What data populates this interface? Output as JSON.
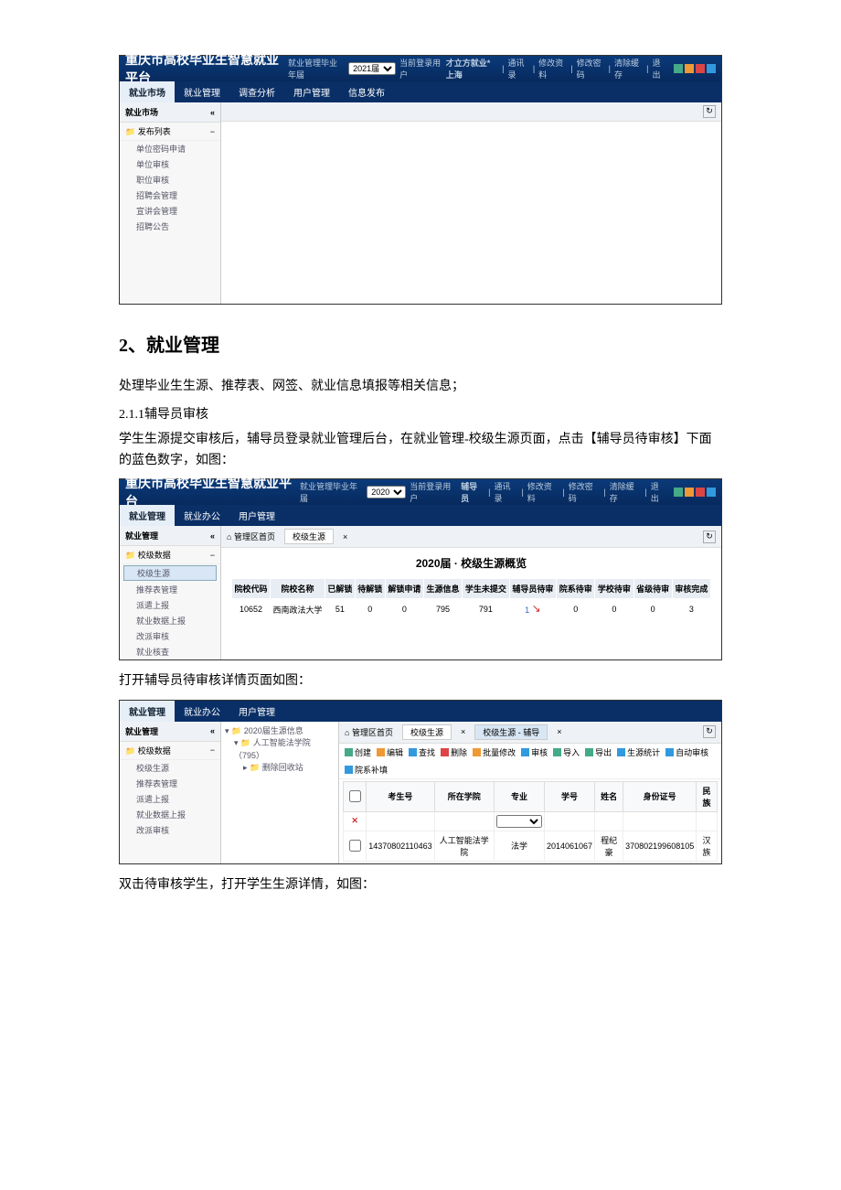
{
  "doc": {
    "section_heading": "2、就业管理",
    "para1": "处理毕业生生源、推荐表、网签、就业信息填报等相关信息；",
    "sub1": "2.1.1辅导员审核",
    "para2": "学生生源提交审核后，辅导员登录就业管理后台，在就业管理-校级生源页面，点击【辅导员待审核】下面的蓝色数字，如图：",
    "para3": "打开辅导员待审核详情页面如图：",
    "para4": "双击待审核学生，打开学生生源详情，如图："
  },
  "shot1": {
    "app_title": "重庆市高校毕业生智慧就业平台",
    "year_label": "就业管理毕业年届",
    "year_value": "2021届",
    "user_label": "当前登录用户",
    "user_value": "才立方就业*上海",
    "links": [
      "通讯录",
      "修改资料",
      "修改密码",
      "清除缓存",
      "退出"
    ],
    "tabs": [
      "就业市场",
      "就业管理",
      "调查分析",
      "用户管理",
      "信息发布"
    ],
    "side_head": "就业市场",
    "side_group": "发布列表",
    "side_items": [
      "单位密码申请",
      "单位审核",
      "职位审核",
      "招聘会管理",
      "宣讲会管理",
      "招聘公告"
    ]
  },
  "shot2": {
    "app_title": "重庆市高校毕业生智慧就业平台",
    "year_label": "就业管理毕业年届",
    "year_value": "2020",
    "user_label": "当前登录用户",
    "user_value": "辅导员",
    "links": [
      "通讯录",
      "修改资料",
      "修改密码",
      "清除缓存",
      "退出"
    ],
    "tabs": [
      "就业管理",
      "就业办公",
      "用户管理"
    ],
    "side_head": "就业管理",
    "side_group": "校级数据",
    "side_items": [
      "校级生源",
      "推荐表管理",
      "派遣上报",
      "就业数据上报",
      "改派审核",
      "就业核查"
    ],
    "crumb_home": "管理区首页",
    "crumb_page": "校级生源",
    "overview_title": "2020届 · 校级生源概览",
    "cols": [
      "院校代码",
      "院校名称",
      "已解锁",
      "待解锁",
      "解锁申请",
      "生源信息",
      "学生未提交",
      "辅导员待审",
      "院系待审",
      "学校待审",
      "省级待审",
      "审核完成"
    ],
    "row": [
      "10652",
      "西南政法大学",
      "51",
      "0",
      "0",
      "795",
      "791",
      "1",
      "0",
      "0",
      "0",
      "3"
    ]
  },
  "shot3": {
    "tabs": [
      "就业管理",
      "就业办公",
      "用户管理"
    ],
    "side_head": "就业管理",
    "side_group": "校级数据",
    "side_items": [
      "校级生源",
      "推荐表管理",
      "派遣上报",
      "就业数据上报",
      "改派审核"
    ],
    "tree_root": "2020届生源信息",
    "tree_node": "人工智能法学院（795）",
    "tree_leaf": "删除回收站",
    "crumb_home": "管理区首页",
    "crumb_mid": "校级生源",
    "crumb_page": "校级生源 - 辅导",
    "tool_buttons": [
      "创建",
      "编辑",
      "查找",
      "删除",
      "批量修改",
      "审核",
      "导入",
      "导出",
      "生源统计",
      "自动审核",
      "院系补填"
    ],
    "grid_cols": [
      "",
      "考生号",
      "所在学院",
      "专业",
      "学号",
      "姓名",
      "身份证号",
      "民族"
    ],
    "grid_row": [
      "",
      "14370802110463",
      "人工智能法学院",
      "法学",
      "2014061067",
      "程纪豪",
      "370802199608105",
      "汉族"
    ]
  }
}
